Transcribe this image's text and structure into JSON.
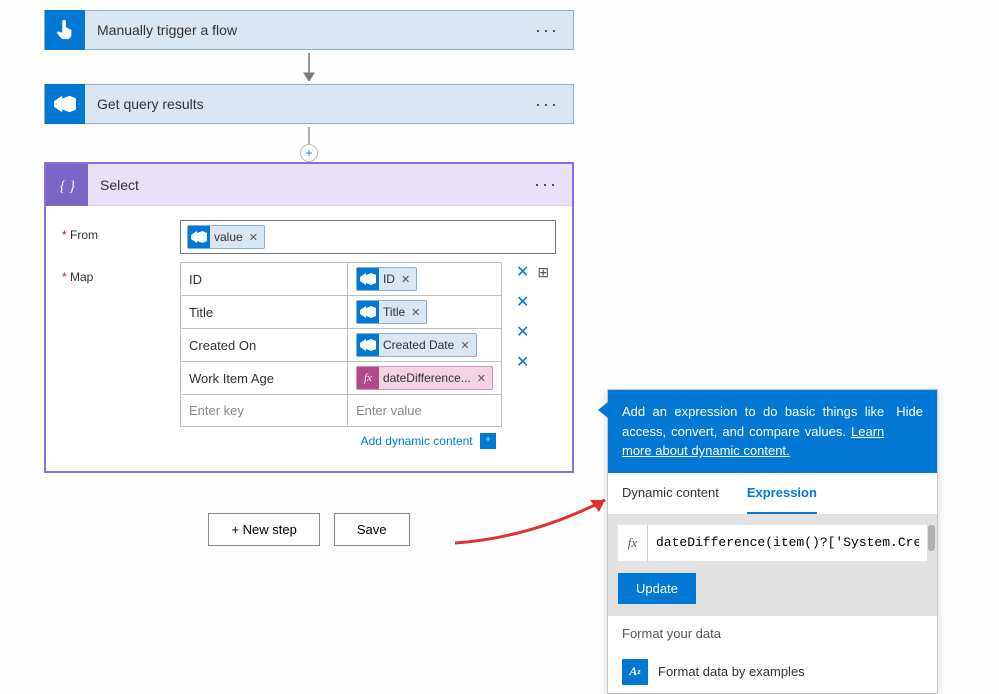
{
  "steps": {
    "trigger": {
      "title": "Manually trigger a flow"
    },
    "query": {
      "title": "Get query results"
    },
    "select": {
      "title": "Select"
    }
  },
  "select": {
    "from_label": "From",
    "map_label": "Map",
    "from_token": "value",
    "map_rows": [
      {
        "key": "ID",
        "val": "ID",
        "type": "az"
      },
      {
        "key": "Title",
        "val": "Title",
        "type": "az"
      },
      {
        "key": "Created On",
        "val": "Created Date",
        "type": "az"
      },
      {
        "key": "Work Item Age",
        "val": "dateDifference...",
        "type": "fx"
      }
    ],
    "key_placeholder": "Enter key",
    "value_placeholder": "Enter value",
    "dynamic_link": "Add dynamic content"
  },
  "footer": {
    "new_step": "+ New step",
    "save": "Save"
  },
  "panel": {
    "banner_text_1": "Add an expression to do basic things like access, convert, and compare values. ",
    "banner_link": "Learn more about dynamic content.",
    "hide": "Hide",
    "tab_dynamic": "Dynamic content",
    "tab_expression": "Expression",
    "fx": "fx",
    "expression": "dateDifference(item()?['System.CreatedDate",
    "update": "Update",
    "format_header": "Format your data",
    "format_item": "Format data by examples"
  }
}
